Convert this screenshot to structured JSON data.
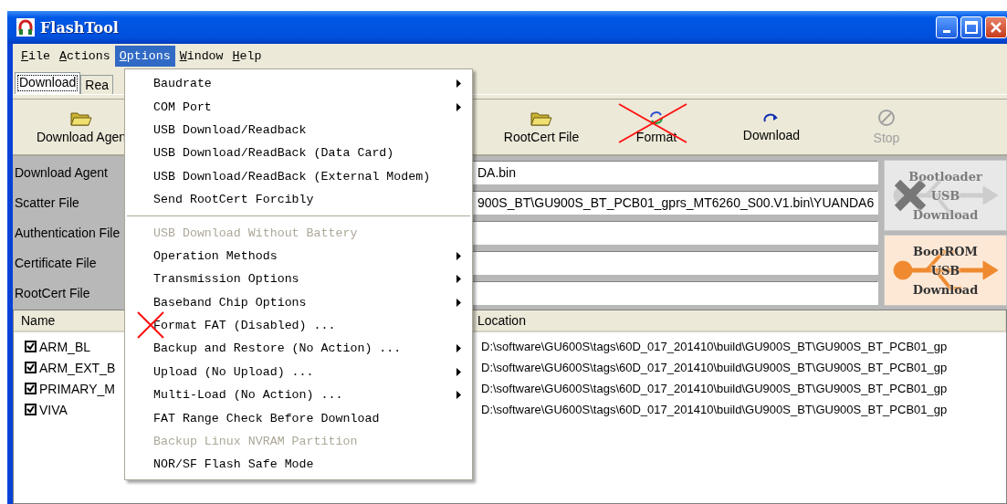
{
  "window": {
    "title": "FlashTool"
  },
  "menubar": [
    {
      "label": "File",
      "selected": false
    },
    {
      "label": "Actions",
      "selected": false
    },
    {
      "label": "Options",
      "selected": true
    },
    {
      "label": "Window",
      "selected": false
    },
    {
      "label": "Help",
      "selected": false
    }
  ],
  "tabs": [
    {
      "label": "Download",
      "selected": true
    },
    {
      "label": "Rea",
      "selected": false
    }
  ],
  "toolbar": [
    {
      "label": "Download Agen",
      "kind": "folder",
      "disabled": false,
      "crossed": false
    },
    {
      "label": "RootCert File",
      "kind": "folder",
      "disabled": false,
      "crossed": false
    },
    {
      "label": "Format",
      "kind": "format",
      "disabled": false,
      "crossed": true
    },
    {
      "label": "Download",
      "kind": "download",
      "disabled": false,
      "crossed": false
    },
    {
      "label": "Stop",
      "kind": "stop",
      "disabled": true,
      "crossed": false
    }
  ],
  "fields": [
    {
      "label": "Download Agent",
      "value": "DA.bin"
    },
    {
      "label": "Scatter File",
      "value": "900S_BT\\GU900S_BT_PCB01_gprs_MT6260_S00.V1.bin\\YUANDA6"
    },
    {
      "label": "Authentication File"
    },
    {
      "label": "Certificate File"
    },
    {
      "label": "RootCert File"
    }
  ],
  "side_buttons": [
    {
      "lines": [
        "Bootloader",
        "USB",
        "Download"
      ],
      "disabled": true
    },
    {
      "lines": [
        "BootROM",
        "USB",
        "Download"
      ],
      "disabled": false
    }
  ],
  "table": {
    "columns": [
      "Name",
      "Location"
    ],
    "rows": [
      {
        "name": "ARM_BL",
        "checked": true,
        "location": "D:\\software\\GU600S\\tags\\60D_017_201410\\build\\GU900S_BT\\GU900S_BT_PCB01_gp"
      },
      {
        "name": "ARM_EXT_B",
        "checked": true,
        "location": "D:\\software\\GU600S\\tags\\60D_017_201410\\build\\GU900S_BT\\GU900S_BT_PCB01_gp"
      },
      {
        "name": "PRIMARY_M",
        "checked": true,
        "location": "D:\\software\\GU600S\\tags\\60D_017_201410\\build\\GU900S_BT\\GU900S_BT_PCB01_gp"
      },
      {
        "name": "VIVA",
        "checked": true,
        "location": "D:\\software\\GU600S\\tags\\60D_017_201410\\build\\GU900S_BT\\GU900S_BT_PCB01_gp"
      }
    ]
  },
  "menu": {
    "items": [
      {
        "kind": "item",
        "label": "Baudrate",
        "submenu": true,
        "disabled": false,
        "crossed": false
      },
      {
        "kind": "item",
        "label": "COM Port",
        "submenu": true,
        "disabled": false,
        "crossed": false
      },
      {
        "kind": "item",
        "label": "USB Download/Readback",
        "submenu": false,
        "disabled": false,
        "crossed": false
      },
      {
        "kind": "item",
        "label": "USB Download/ReadBack (Data Card)",
        "submenu": false,
        "disabled": false,
        "crossed": false
      },
      {
        "kind": "item",
        "label": "USB Download/ReadBack (External Modem)",
        "submenu": false,
        "disabled": false,
        "crossed": false
      },
      {
        "kind": "item",
        "label": "Send RootCert Forcibly",
        "submenu": false,
        "disabled": false,
        "crossed": false
      },
      {
        "kind": "separator"
      },
      {
        "kind": "item",
        "label": "USB Download Without Battery",
        "submenu": false,
        "disabled": true,
        "crossed": false
      },
      {
        "kind": "item",
        "label": "Operation Methods",
        "submenu": true,
        "disabled": false,
        "crossed": false
      },
      {
        "kind": "item",
        "label": "Transmission Options",
        "submenu": true,
        "disabled": false,
        "crossed": false
      },
      {
        "kind": "item",
        "label": "Baseband Chip Options",
        "submenu": true,
        "disabled": false,
        "crossed": false
      },
      {
        "kind": "item",
        "label": "Format FAT (Disabled) ...",
        "submenu": false,
        "disabled": false,
        "crossed": true
      },
      {
        "kind": "item",
        "label": "Backup and Restore (No Action) ...",
        "submenu": true,
        "disabled": false,
        "crossed": false
      },
      {
        "kind": "item",
        "label": "Upload (No Upload) ...",
        "submenu": true,
        "disabled": false,
        "crossed": false
      },
      {
        "kind": "item",
        "label": "Multi-Load (No Action) ...",
        "submenu": true,
        "disabled": false,
        "crossed": false
      },
      {
        "kind": "item",
        "label": "FAT Range Check Before Download",
        "submenu": false,
        "disabled": false,
        "crossed": false
      },
      {
        "kind": "item",
        "label": "Backup Linux NVRAM Partition",
        "submenu": false,
        "disabled": true,
        "crossed": false
      },
      {
        "kind": "item",
        "label": "NOR/SF Flash Safe Mode",
        "submenu": false,
        "disabled": false,
        "crossed": false
      }
    ]
  }
}
